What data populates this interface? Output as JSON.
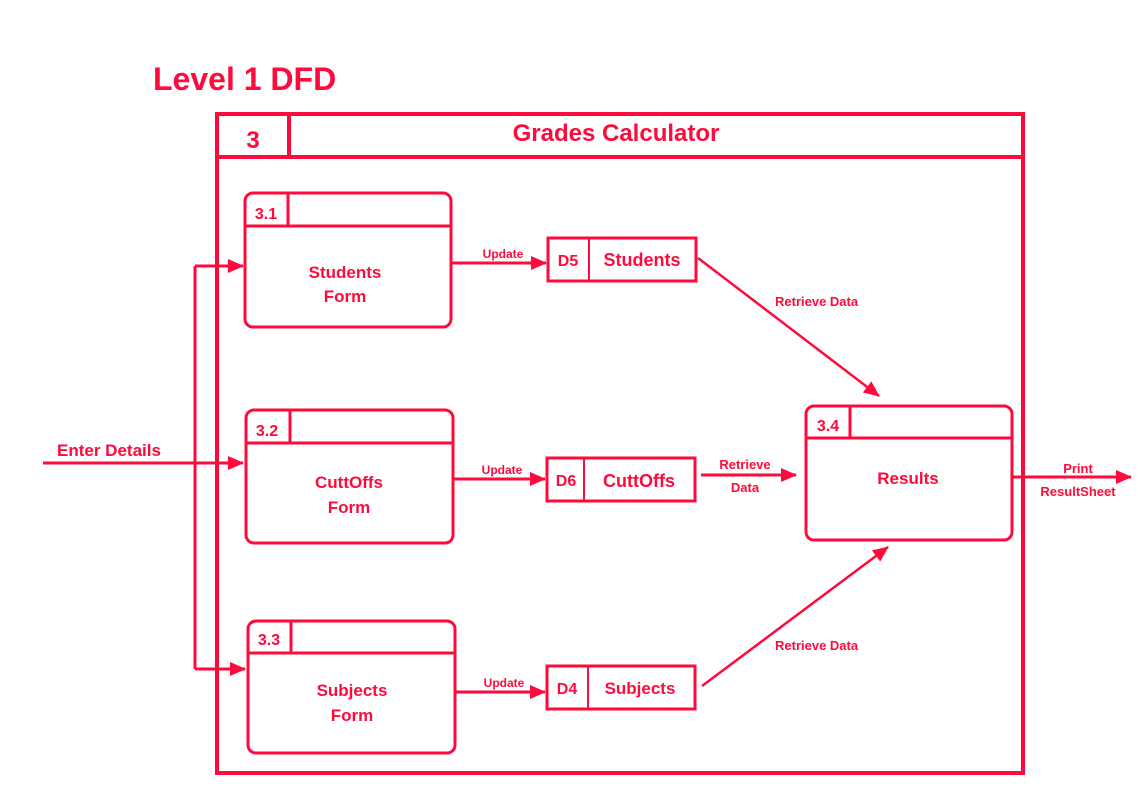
{
  "title": "Level 1 DFD",
  "colors": {
    "primary": "#ff0a3c",
    "background": "#ffffff"
  },
  "container": {
    "id": "3",
    "name": "Grades Calculator"
  },
  "processes": [
    {
      "id": "3.1",
      "line1": "Students",
      "line2": "Form"
    },
    {
      "id": "3.2",
      "line1": "CuttOffs",
      "line2": "Form"
    },
    {
      "id": "3.3",
      "line1": "Subjects",
      "line2": "Form"
    },
    {
      "id": "3.4",
      "line1": "Results",
      "line2": ""
    }
  ],
  "data_stores": [
    {
      "id": "D5",
      "name": "Students"
    },
    {
      "id": "D6",
      "name": "CuttOffs"
    },
    {
      "id": "D4",
      "name": "Subjects"
    }
  ],
  "flows": {
    "input": "Enter Details",
    "update_1": "Update",
    "update_2": "Update",
    "update_3": "Update",
    "retrieve_d5": "Retrieve Data",
    "retrieve_d6_line1": "Retrieve",
    "retrieve_d6_line2": "Data",
    "retrieve_d4": "Retrieve Data",
    "output_line1": "Print",
    "output_line2": "ResultSheet"
  }
}
